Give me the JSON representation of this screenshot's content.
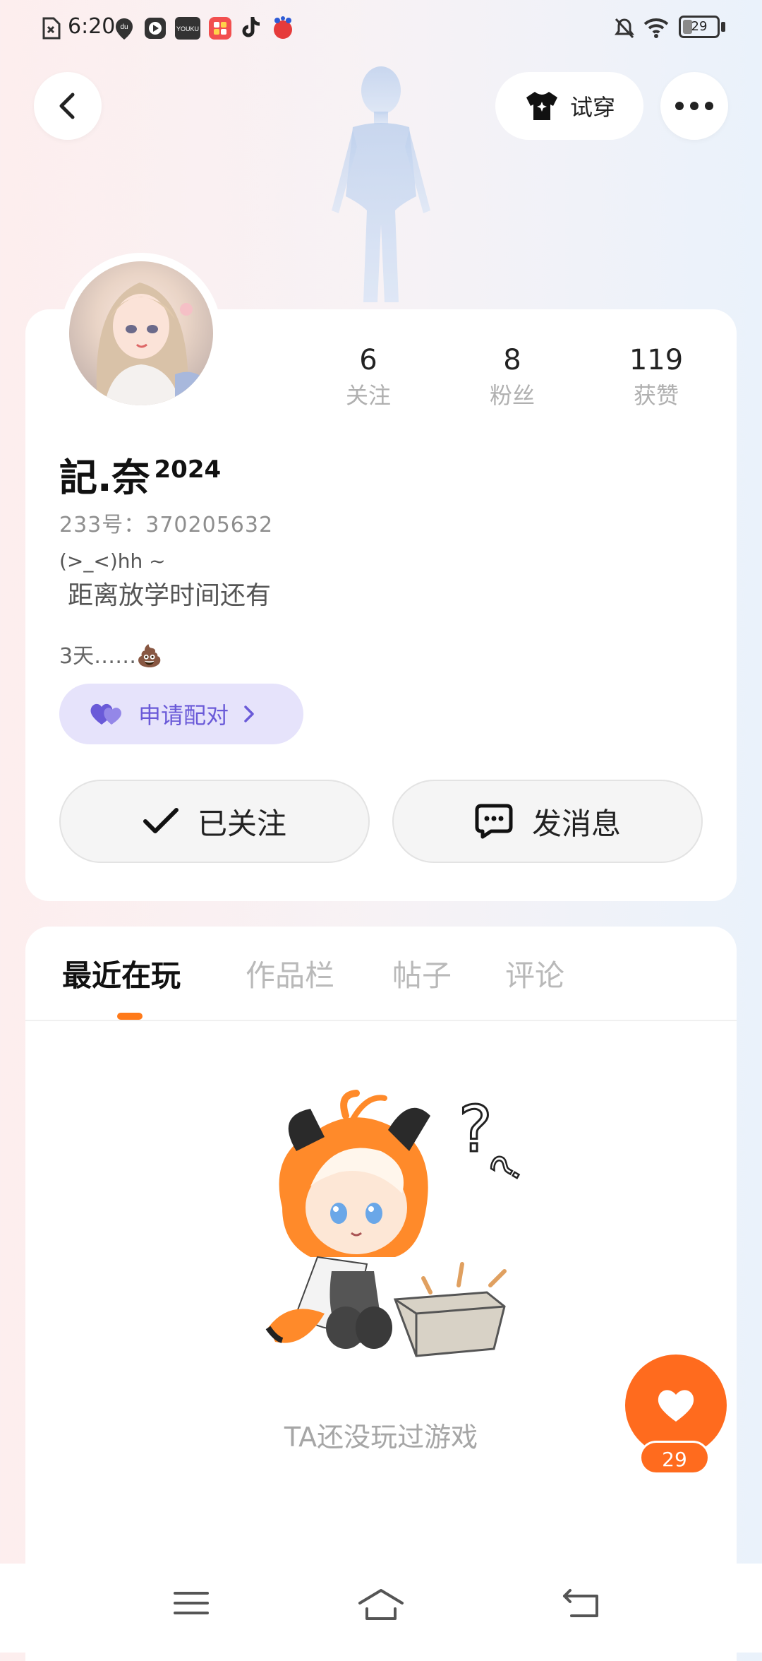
{
  "status_bar": {
    "time": "6:20",
    "battery_level": "29",
    "battery_fraction": 0.29,
    "app_icons": [
      "sim-icon",
      "location-icon",
      "play-icon",
      "youku-icon",
      "app-icon",
      "tiktok-icon",
      "baidu-icon"
    ],
    "youku_label": "YOUKU",
    "du_label": "du"
  },
  "header": {
    "tryon_label": "试穿"
  },
  "profile": {
    "stats": [
      {
        "value": "6",
        "label": "关注"
      },
      {
        "value": "8",
        "label": "粉丝"
      },
      {
        "value": "119",
        "label": "获赞"
      }
    ],
    "username": "記.奈",
    "username_suffix": "2024",
    "uid": "233号：370205632",
    "bio_line1": "(>_<)hh ~",
    "bio_line2": "距离放学时间还有",
    "bio_line3": "3天……💩",
    "pair_label": "申请配对",
    "follow_label": "已关注",
    "message_label": "发消息"
  },
  "tabs": [
    {
      "label": "最近在玩",
      "active": true
    },
    {
      "label": "作品栏",
      "active": false
    },
    {
      "label": "帖子",
      "active": false
    },
    {
      "label": "评论",
      "active": false
    }
  ],
  "empty_state": {
    "text": "TA还没玩过游戏"
  },
  "like": {
    "count": "29"
  },
  "colors": {
    "accent": "#ff6b1e",
    "pair_bg": "#e6e3fb",
    "pair_text": "#6a5ad8"
  }
}
